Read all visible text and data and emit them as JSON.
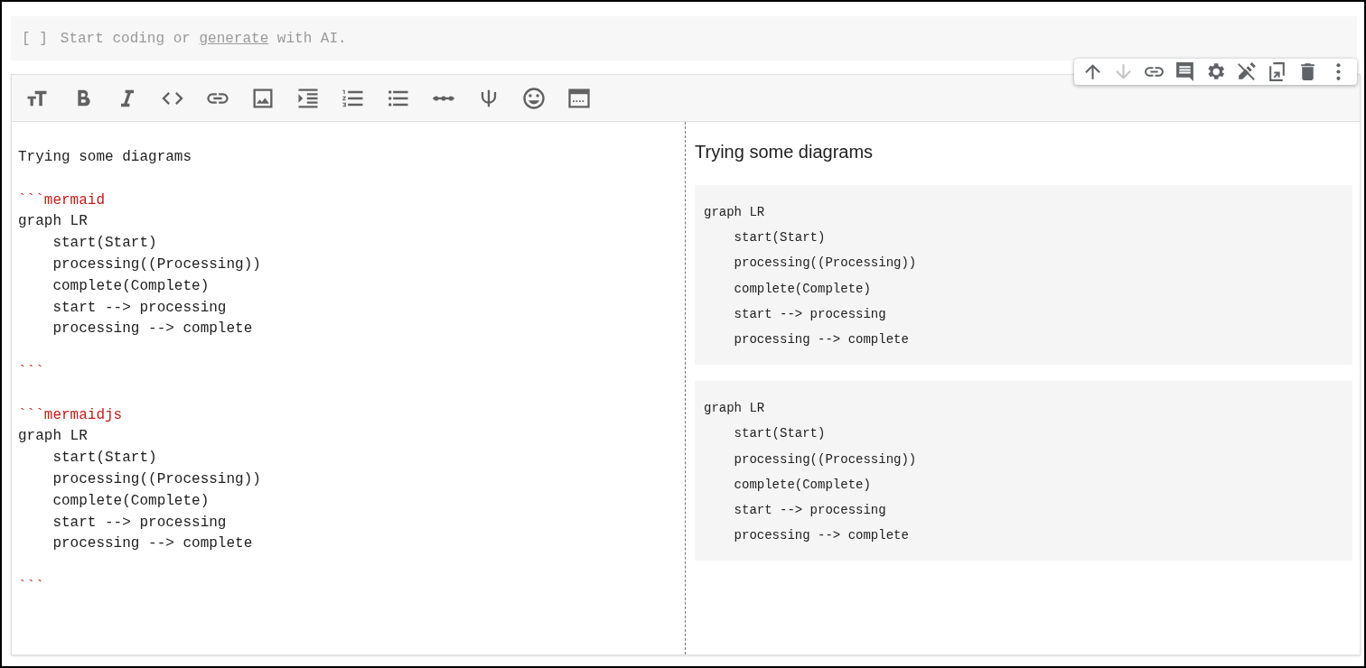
{
  "code_cell": {
    "bracket": "[ ]",
    "placeholder_before": "Start coding or ",
    "placeholder_link": "generate",
    "placeholder_after": " with AI."
  },
  "cell_toolbar": [
    {
      "kind": "up",
      "disabled": false
    },
    {
      "kind": "down",
      "disabled": true
    },
    {
      "kind": "link",
      "disabled": false
    },
    {
      "kind": "comment",
      "disabled": false
    },
    {
      "kind": "settings",
      "disabled": false
    },
    {
      "kind": "edit-off",
      "disabled": false
    },
    {
      "kind": "mirror",
      "disabled": false
    },
    {
      "kind": "delete",
      "disabled": false
    },
    {
      "kind": "more",
      "disabled": false
    }
  ],
  "format_toolbar": [
    {
      "kind": "heading"
    },
    {
      "kind": "bold"
    },
    {
      "kind": "italic"
    },
    {
      "kind": "code"
    },
    {
      "kind": "link"
    },
    {
      "kind": "image"
    },
    {
      "kind": "indent"
    },
    {
      "kind": "numbered-list"
    },
    {
      "kind": "bulleted-list"
    },
    {
      "kind": "rule"
    },
    {
      "kind": "psi"
    },
    {
      "kind": "emoji"
    },
    {
      "kind": "table"
    }
  ],
  "editor_lines": [
    {
      "kind": "text",
      "text": "Trying some diagrams"
    },
    {
      "kind": "blank"
    },
    {
      "kind": "fence",
      "text": "```mermaid"
    },
    {
      "kind": "text",
      "text": "graph LR"
    },
    {
      "kind": "text",
      "text": "    start(Start)"
    },
    {
      "kind": "text",
      "text": "    processing((Processing))"
    },
    {
      "kind": "text",
      "text": "    complete(Complete)"
    },
    {
      "kind": "text",
      "text": "    start --> processing"
    },
    {
      "kind": "text",
      "text": "    processing --> complete"
    },
    {
      "kind": "blank"
    },
    {
      "kind": "fence",
      "text": "```"
    },
    {
      "kind": "blank"
    },
    {
      "kind": "fence",
      "text": "```mermaidjs"
    },
    {
      "kind": "text",
      "text": "graph LR"
    },
    {
      "kind": "text",
      "text": "    start(Start)"
    },
    {
      "kind": "text",
      "text": "    processing((Processing))"
    },
    {
      "kind": "text",
      "text": "    complete(Complete)"
    },
    {
      "kind": "text",
      "text": "    start --> processing"
    },
    {
      "kind": "text",
      "text": "    processing --> complete"
    },
    {
      "kind": "blank"
    },
    {
      "kind": "fence",
      "text": "```"
    }
  ],
  "preview": {
    "heading": "Trying some diagrams",
    "code_blocks": [
      [
        "graph LR",
        "    start(Start)",
        "    processing((Processing))",
        "    complete(Complete)",
        "    start --> processing",
        "    processing --> complete"
      ],
      [
        "graph LR",
        "    start(Start)",
        "    processing((Processing))",
        "    complete(Complete)",
        "    start --> processing",
        "    processing --> complete"
      ]
    ]
  }
}
